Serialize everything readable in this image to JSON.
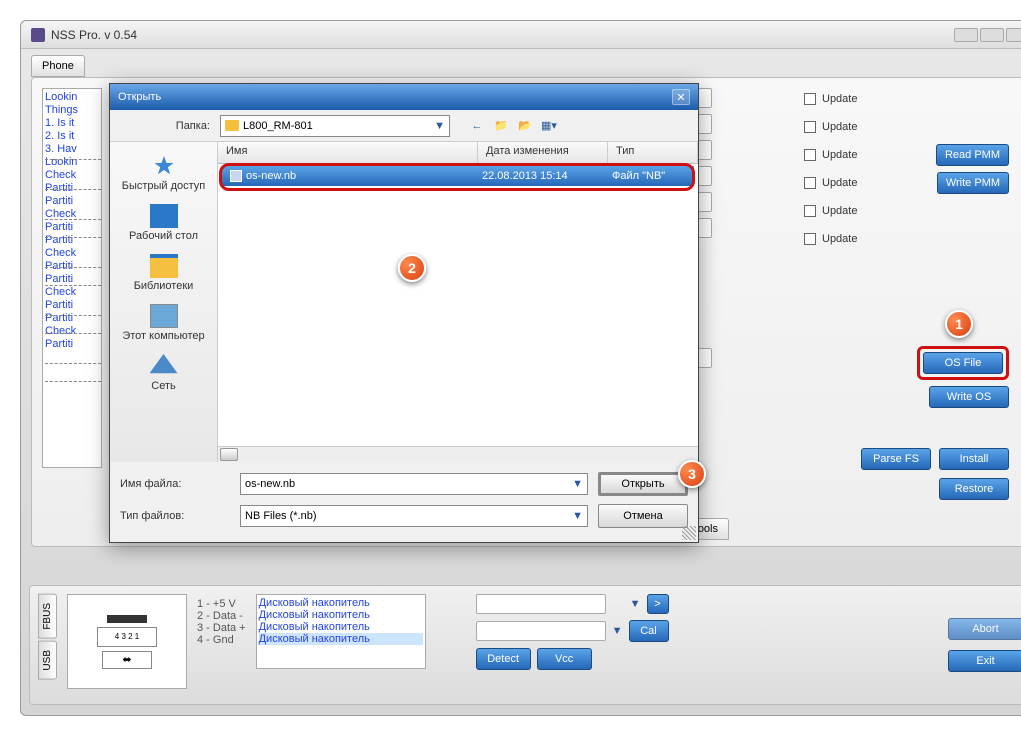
{
  "title": "NSS Pro. v 0.54",
  "tabs": {
    "phone": "Phone",
    "wp7": "WP7 Tools"
  },
  "log_lines": [
    "Lookin",
    "Things",
    "1. Is it",
    "2. Is it",
    "3. Hav",
    "Lookin",
    "Check",
    "Partiti",
    "Partiti",
    "Check",
    "Partiti",
    "Partiti",
    "Check",
    "Partiti",
    "Partiti",
    "Check",
    "Partiti",
    "Partiti",
    "Check",
    "Partiti"
  ],
  "right": {
    "update": "Update",
    "read_pmm": "Read PMM",
    "write_pmm": "Write PMM",
    "os_file": "OS File",
    "write_os": "Write OS",
    "parse_fs": "Parse FS",
    "install": "Install",
    "restore": "Restore"
  },
  "bottom": {
    "fbus": "FBUS",
    "usb": "USB",
    "pins": [
      "1 - +5 V",
      "2 - Data -",
      "3 - Data +",
      "4 - Gnd"
    ],
    "usb_label": "4 3 2 1",
    "disks": [
      "Дисковый накопитель",
      "Дисковый накопитель",
      "Дисковый накопитель",
      "Дисковый накопитель"
    ],
    "detect": "Detect",
    "vcc": "Vcc",
    "cal": "Cal",
    "abort": "Abort",
    "exit": "Exit",
    "gt": ">"
  },
  "dialog": {
    "title": "Открыть",
    "folder_label": "Папка:",
    "folder": "L800_RM-801",
    "headers": {
      "name": "Имя",
      "date": "Дата изменения",
      "type": "Тип"
    },
    "file": {
      "name": "os-new.nb",
      "date": "22.08.2013 15:14",
      "type": "Файл \"NB\""
    },
    "places": {
      "quick": "Быстрый доступ",
      "desktop": "Рабочий стол",
      "libs": "Библиотеки",
      "pc": "Этот компьютер",
      "net": "Сеть"
    },
    "fn_label": "Имя файла:",
    "ft_label": "Тип файлов:",
    "filename": "os-new.nb",
    "filetype": "NB Files (*.nb)",
    "open": "Открыть",
    "cancel": "Отмена"
  },
  "callouts": {
    "c1": "1",
    "c2": "2",
    "c3": "3"
  }
}
